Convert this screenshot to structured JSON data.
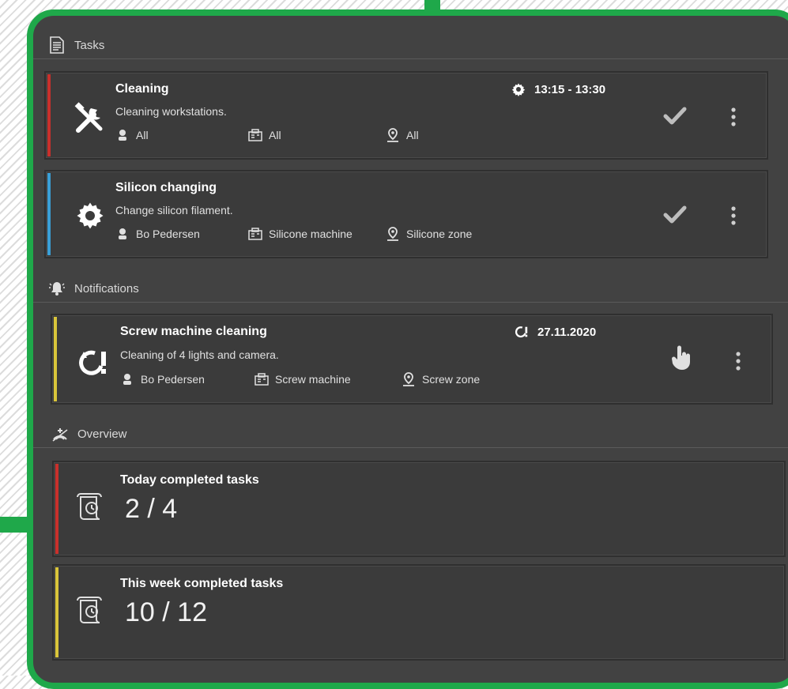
{
  "colors": {
    "frame": "#1fa84a",
    "panel": "#424242",
    "card": "#3b3b3b",
    "accent_red": "#c9302c",
    "accent_blue": "#3aa0d8",
    "accent_yellow": "#d9c53a"
  },
  "sections": {
    "tasks": "Tasks",
    "notifications": "Notifications",
    "overview": "Overview"
  },
  "tasks": [
    {
      "title": "Cleaning",
      "description": "Cleaning workstations.",
      "time": "13:15 - 13:30",
      "worker": "All",
      "machine": "All",
      "zone": "All",
      "icon": "tools-icon",
      "accent": "red"
    },
    {
      "title": "Silicon changing",
      "description": "Change silicon filament.",
      "time": "",
      "worker": "Bo Pedersen",
      "machine": "Silicone machine",
      "zone": "Silicone zone",
      "icon": "gear-icon",
      "accent": "blue"
    }
  ],
  "notifications": [
    {
      "title": "Screw machine cleaning",
      "description": "Cleaning of 4 lights and camera.",
      "date": "27.11.2020",
      "worker": "Bo Pedersen",
      "machine": "Screw machine",
      "zone": "Screw zone",
      "icon": "overdue-icon",
      "accent": "yellow"
    }
  ],
  "overview": [
    {
      "label": "Today completed tasks",
      "value": "2 / 4",
      "accent": "red"
    },
    {
      "label": "This week completed tasks",
      "value": "10 / 12",
      "accent": "yellow"
    }
  ]
}
